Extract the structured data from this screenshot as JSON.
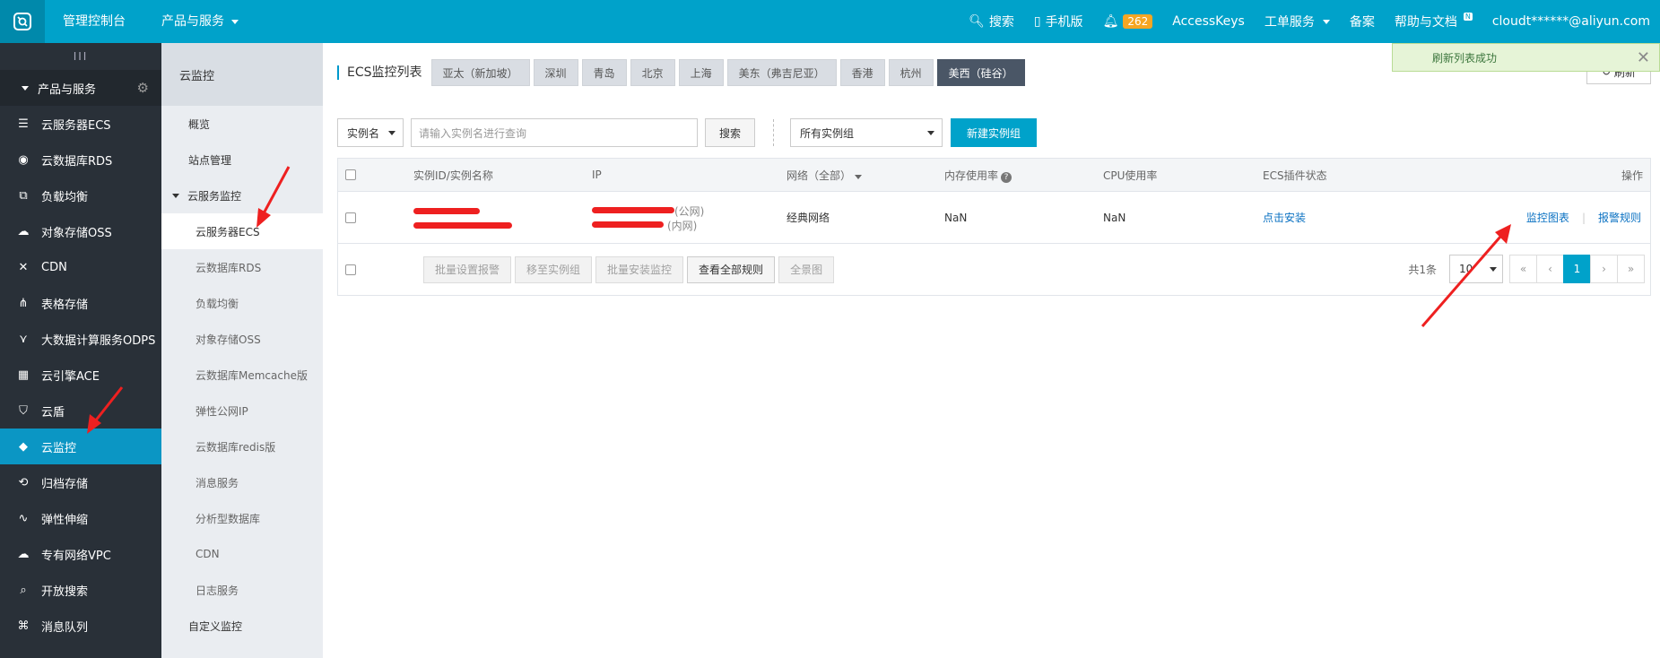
{
  "topbar": {
    "console": "管理控制台",
    "products": "产品与服务",
    "search": "搜索",
    "mobile": "手机版",
    "bell_count": "262",
    "accesskeys": "AccessKeys",
    "ticket": "工单服务",
    "beian": "备案",
    "help": "帮助与文档",
    "help_badge": "N",
    "account": "cloudt******@aliyun.com"
  },
  "sidebar": {
    "collapse": "III",
    "group": "产品与服务",
    "items": [
      {
        "label": "云服务器ECS",
        "icon": "server-icon"
      },
      {
        "label": "云数据库RDS",
        "icon": "database-icon"
      },
      {
        "label": "负载均衡",
        "icon": "load-balance-icon"
      },
      {
        "label": "对象存储OSS",
        "icon": "cloud-storage-icon"
      },
      {
        "label": "CDN",
        "icon": "cdn-icon"
      },
      {
        "label": "表格存储",
        "icon": "table-store-icon"
      },
      {
        "label": "大数据计算服务ODPS",
        "icon": "bigdata-icon"
      },
      {
        "label": "云引擎ACE",
        "icon": "engine-icon"
      },
      {
        "label": "云盾",
        "icon": "shield-icon"
      },
      {
        "label": "云监控",
        "icon": "monitor-icon"
      },
      {
        "label": "归档存储",
        "icon": "archive-icon"
      },
      {
        "label": "弹性伸缩",
        "icon": "autoscale-icon"
      },
      {
        "label": "专有网络VPC",
        "icon": "vpc-icon"
      },
      {
        "label": "开放搜索",
        "icon": "open-search-icon"
      },
      {
        "label": "消息队列",
        "icon": "message-queue-icon"
      }
    ]
  },
  "subnav": {
    "title": "云监控",
    "overview": "概览",
    "site": "站点管理",
    "group": "云服务监控",
    "children": [
      "云服务器ECS",
      "云数据库RDS",
      "负载均衡",
      "对象存储OSS",
      "云数据库Memcache版",
      "弹性公网IP",
      "云数据库redis版",
      "消息服务",
      "分析型数据库",
      "CDN",
      "日志服务"
    ],
    "custom": "自定义监控"
  },
  "main": {
    "title": "ECS监控列表",
    "regions": [
      "亚太（新加坡）",
      "深圳",
      "青岛",
      "北京",
      "上海",
      "美东（弗吉尼亚）",
      "香港",
      "杭州",
      "美西（硅谷）"
    ],
    "refresh": "刷新",
    "toast": "刷新列表成功",
    "filter_select": "实例名",
    "search_placeholder": "请输入实例名进行查询",
    "search_btn": "搜索",
    "group_select": "所有实例组",
    "new_group_btn": "新建实例组",
    "columns": {
      "id": "实例ID/实例名称",
      "ip": "IP",
      "network": "网络（全部）",
      "mem": "内存使用率",
      "cpu": "CPU使用率",
      "plugin": "ECS插件状态",
      "ops": "操作"
    },
    "row": {
      "ip_public": "(公网)",
      "ip_private": "(内网)",
      "network": "经典网络",
      "mem": "NaN",
      "cpu": "NaN",
      "plugin": "点击安装",
      "op_chart": "监控图表",
      "op_rule": "报警规则"
    },
    "footer": {
      "btn_batch_alarm": "批量设置报警",
      "btn_move": "移至实例组",
      "btn_batch_install": "批量安装监控",
      "btn_view_rules": "查看全部规则",
      "btn_full": "全景图",
      "total": "共1条",
      "page_size": "10",
      "first": "«",
      "prev": "‹",
      "page": "1",
      "next": "›",
      "last": "»"
    }
  },
  "colors": {
    "topbar": "#00a2ca",
    "sidebar": "#293038",
    "accent": "#00a2ca",
    "annotation": "#ee2020"
  }
}
